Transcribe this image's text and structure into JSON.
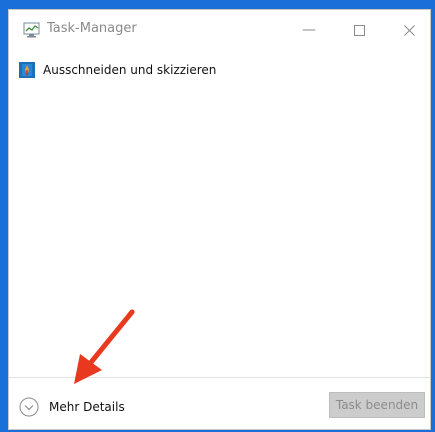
{
  "window": {
    "title": "Task-Manager",
    "controls": {
      "minimize_glyph": "—",
      "maximize_glyph": "☐",
      "close_glyph": "✕"
    }
  },
  "tasks": [
    {
      "label": "Ausschneiden und skizzieren",
      "icon": "snip-sketch-icon"
    }
  ],
  "footer": {
    "details_label": "Mehr Details",
    "end_task_label": "Task beenden"
  },
  "colors": {
    "background": "#1a6fd8",
    "arrow": "#e8391f",
    "title_text": "#8a8a8a",
    "disabled_button": "#cccccc"
  }
}
